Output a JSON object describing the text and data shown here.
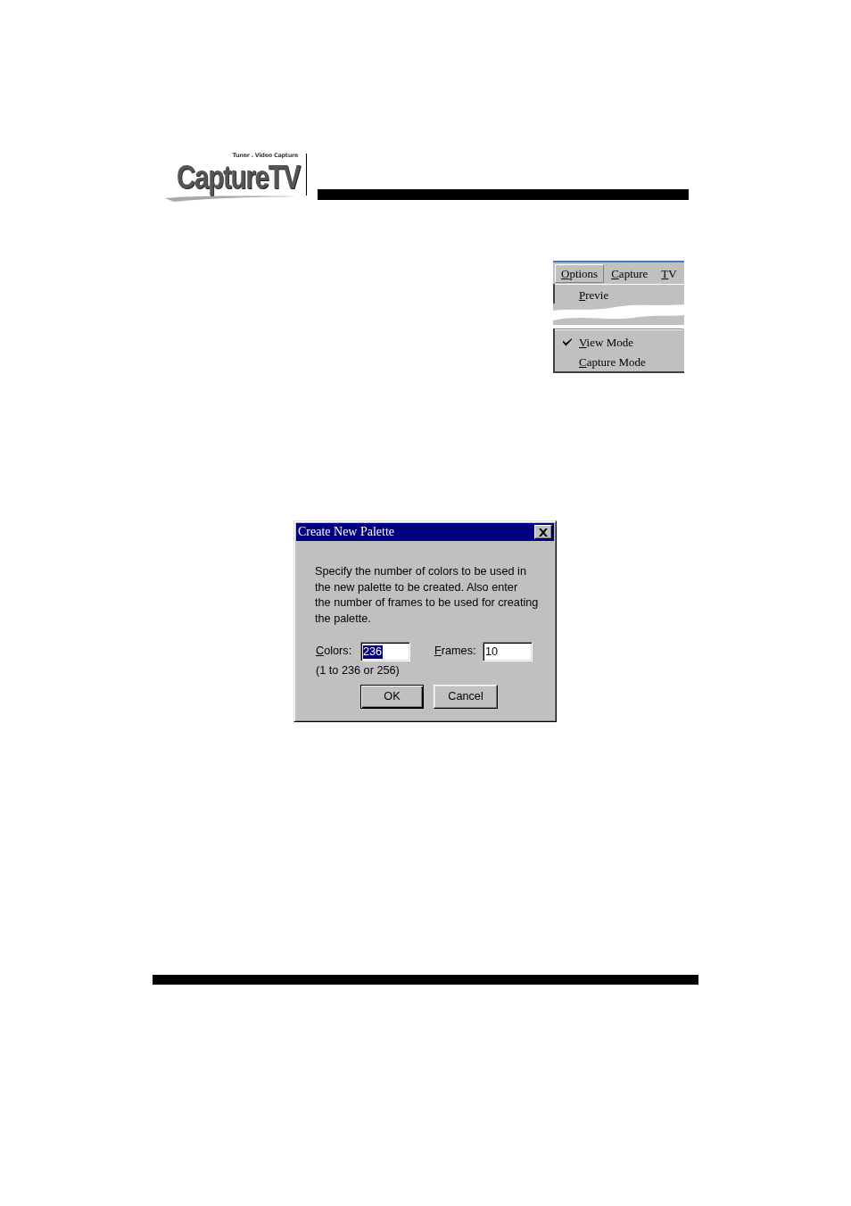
{
  "header": {
    "logo": {
      "tagline": "Tuner . Video Capture",
      "wordmark": "CaptureTV"
    }
  },
  "menu_screenshot": {
    "menu_bar": [
      {
        "label": "Options",
        "selected": true
      },
      {
        "label": "Capture",
        "selected": false
      },
      {
        "label": "TV",
        "selected": false
      }
    ],
    "menu_items": [
      {
        "kind": "item",
        "label": "Previe",
        "checked": false
      },
      {
        "kind": "tear"
      },
      {
        "kind": "separator"
      },
      {
        "kind": "item",
        "label": "View Mode",
        "checked": true
      },
      {
        "kind": "item",
        "label": "Capture Mode",
        "checked": false
      }
    ]
  },
  "dialog": {
    "title": "Create New Palette",
    "message": "Specify the number of colors to be used in\nthe new palette to be created. Also enter\nthe number of frames to be used for creating\nthe palette.",
    "fields": [
      {
        "label": "Colors:",
        "value": "236",
        "selected": true
      },
      {
        "label": "Frames:",
        "value": "10",
        "selected": false
      }
    ],
    "hint": "(1 to 236 or 256)",
    "buttons": [
      {
        "label": "OK",
        "default": true
      },
      {
        "label": "Cancel",
        "default": false
      }
    ]
  }
}
